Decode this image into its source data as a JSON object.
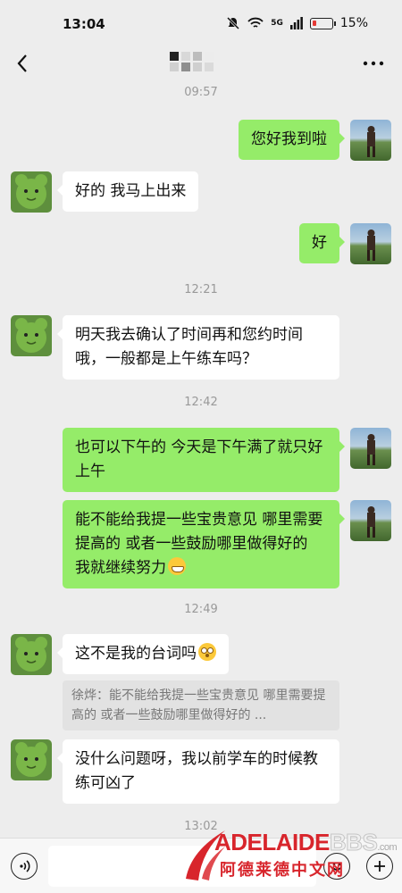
{
  "status": {
    "time": "13:04",
    "signal": "5G",
    "battery": "15%"
  },
  "nav": {
    "title": ""
  },
  "timestamps": [
    "09:57",
    "12:21",
    "12:42",
    "12:49",
    "13:02"
  ],
  "messages": [
    {
      "side": "out",
      "text": "您好我到啦"
    },
    {
      "side": "in",
      "text": "好的 我马上出来"
    },
    {
      "side": "out",
      "text": "好"
    },
    {
      "side": "in",
      "text": "明天我去确认了时间再和您约时间哦，一般都是上午练车吗？"
    },
    {
      "side": "out",
      "text": "也可以下午的 今天是下午满了就只好上午"
    },
    {
      "side": "out",
      "text": "能不能给我提一些宝贵意见 哪里需要提高的 或者一些鼓励哪里做得好的 我就继续努力"
    },
    {
      "side": "in",
      "text": "这不是我的台词吗"
    },
    {
      "side": "in",
      "text": "没什么问题呀，我以前学车的时候教练可凶了"
    }
  ],
  "quote": {
    "text": "徐烨：能不能给我提一些宝贵意见 哪里需要提高的 或者一些鼓励哪里做得好的 ..."
  },
  "input": {
    "placeholder": ""
  },
  "watermark": {
    "brand": "ADELAIDE",
    "brand2": "BBS",
    "domain": ".com",
    "subtitle": "阿德莱德中文网"
  },
  "icons": {
    "back": "chevron-left-icon",
    "more": "more-dots-icon",
    "voice": "voice-icon",
    "emoji": "emoji-icon",
    "plus": "plus-icon"
  },
  "colors": {
    "background": "#ededed",
    "bubble_out": "#95ec69",
    "bubble_in": "#ffffff",
    "watermark": "#d8252c"
  }
}
